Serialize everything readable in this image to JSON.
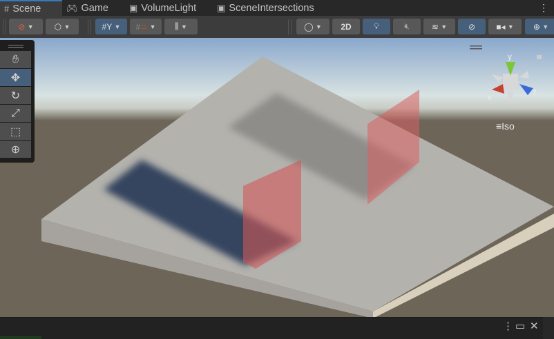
{
  "tabs": [
    {
      "label": "Scene",
      "icon": "grid-icon",
      "active": true
    },
    {
      "label": "Game",
      "icon": "gamepad-icon"
    },
    {
      "label": "VolumeLight",
      "icon": "script-icon"
    },
    {
      "label": "SceneIntersections",
      "icon": "script-icon"
    }
  ],
  "toolbar": {
    "two_d_label": "2D",
    "colors": {
      "active": "#46607c",
      "button": "#585858"
    }
  },
  "gizmo": {
    "x_label": "x",
    "y_label": "y",
    "z_label": "z",
    "projection": "Iso"
  },
  "tools": [
    "hand",
    "move",
    "rotate",
    "scale",
    "rect",
    "transform"
  ]
}
